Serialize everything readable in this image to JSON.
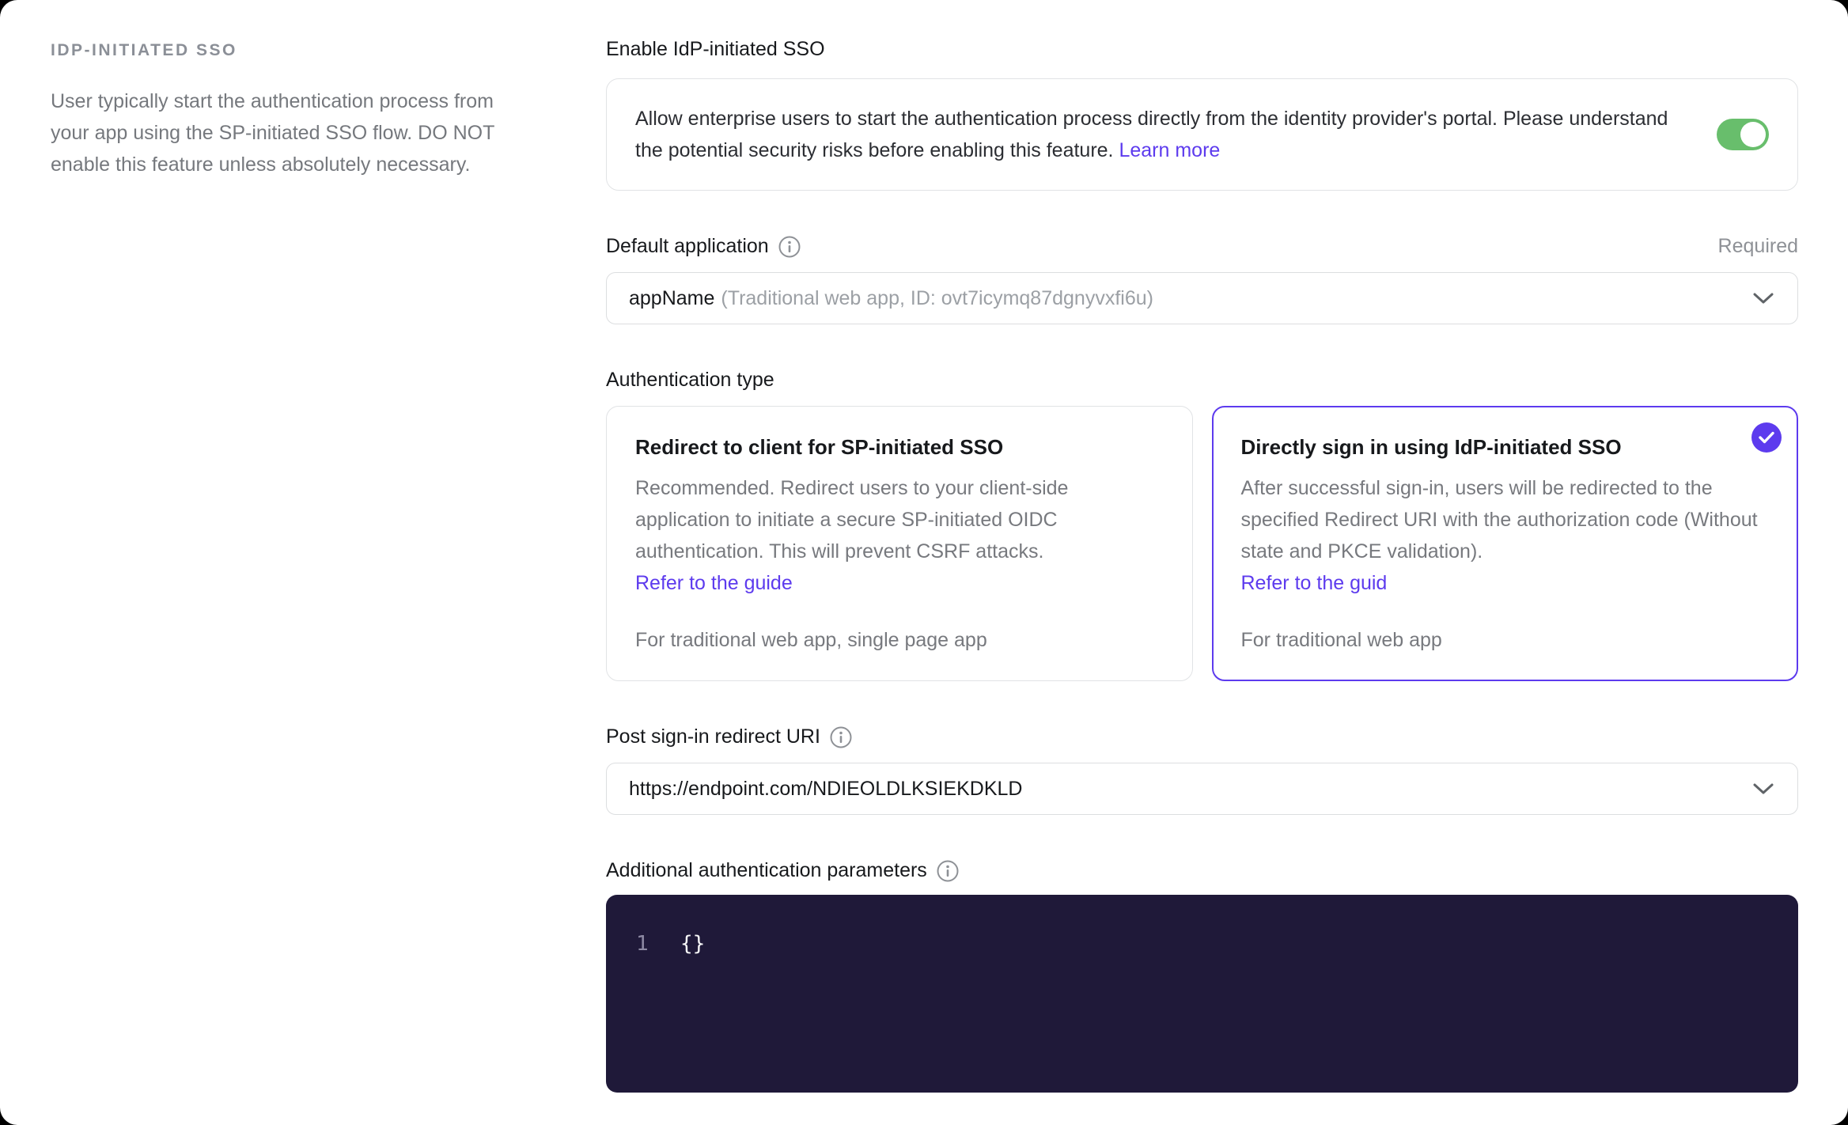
{
  "colors": {
    "accent": "#5d3bee",
    "toggle_on": "#68be6c",
    "editor_bg": "#1f1939"
  },
  "sidebar": {
    "heading": "IDP-INITIATED SSO",
    "description": "User typically start the authentication process from your app using the SP-initiated SSO flow. DO NOT enable this feature unless absolutely necessary."
  },
  "enable_section": {
    "label": "Enable IdP-initiated SSO",
    "description": "Allow enterprise users to start the authentication process directly from the identity provider's portal. Please understand the potential security risks before enabling this feature. ",
    "link": "Learn more",
    "toggle_state": "on"
  },
  "default_application": {
    "label": "Default application",
    "required_badge": "Required",
    "value_primary": "appName",
    "value_secondary": "(Traditional web app, ID: ovt7icymq87dgnyvxfi6u)"
  },
  "authentication_type": {
    "label": "Authentication type",
    "options": [
      {
        "title": "Redirect to client for SP-initiated SSO",
        "description": "Recommended. Redirect users to your client-side application to initiate a secure SP-initiated OIDC authentication. This will prevent CSRF attacks.",
        "link": "Refer to the guide",
        "footer": "For traditional web app, single page app",
        "selected": false
      },
      {
        "title": "Directly sign in using IdP-initiated SSO",
        "description": "After successful sign-in, users will be redirected to the specified Redirect URI with the authorization code (Without state and PKCE validation).",
        "link": "Refer to the guid",
        "footer": "For traditional web app",
        "selected": true
      }
    ]
  },
  "redirect_uri": {
    "label": "Post sign-in redirect URI",
    "value": "https://endpoint.com/NDIEOLDLKSIEKDKLD"
  },
  "additional_params": {
    "label": "Additional authentication parameters",
    "lines": [
      {
        "number": "1",
        "code": "{}"
      }
    ]
  }
}
